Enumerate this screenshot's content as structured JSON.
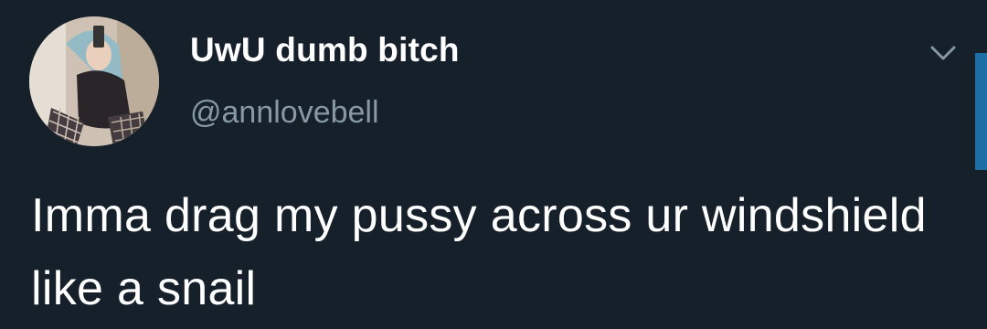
{
  "tweet": {
    "author": {
      "display_name": "UwU dumb bitch",
      "handle": "@annlovebell",
      "avatar_icon": "profile-photo"
    },
    "menu_icon": "chevron-down-icon",
    "text": "Imma drag my pussy across ur windshield like a snail"
  },
  "colors": {
    "background": "#15202b",
    "primary_text": "#ffffff",
    "secondary_text": "#8899a6",
    "accent": "#1d6fa5"
  }
}
